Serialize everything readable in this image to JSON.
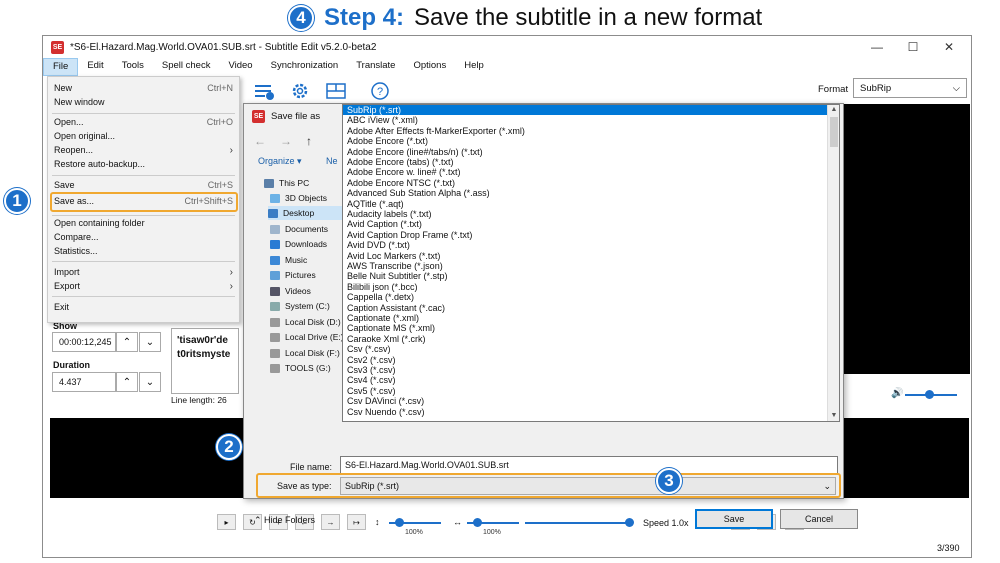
{
  "heading": {
    "number": "4",
    "step": "Step 4:",
    "text": "Save the subtitle in a new format"
  },
  "callouts": {
    "one": "1",
    "two": "2",
    "three": "3"
  },
  "window": {
    "logo": "SE",
    "title": "*S6-El.Hazard.Mag.World.OVA01.SUB.srt - Subtitle Edit v5.2.0-beta2",
    "minimize": "—",
    "maximize": "☐",
    "close": "✕"
  },
  "menubar": [
    "File",
    "Edit",
    "Tools",
    "Spell check",
    "Video",
    "Synchronization",
    "Translate",
    "Options",
    "Help"
  ],
  "format": {
    "label": "Format",
    "value": "SubRip",
    "arrow": "⌵"
  },
  "file_menu": [
    {
      "label": "New",
      "shortcut": "Ctrl+N"
    },
    {
      "label": "New window",
      "shortcut": ""
    },
    {
      "label": "Open...",
      "shortcut": "Ctrl+O"
    },
    {
      "label": "Open original...",
      "shortcut": ""
    },
    {
      "label": "Reopen...",
      "shortcut": "›"
    },
    {
      "label": "Restore auto-backup...",
      "shortcut": ""
    },
    {
      "label": "Save",
      "shortcut": "Ctrl+S"
    },
    {
      "label": "Save as...",
      "shortcut": "Ctrl+Shift+S"
    },
    {
      "label": "Open containing folder",
      "shortcut": ""
    },
    {
      "label": "Compare...",
      "shortcut": ""
    },
    {
      "label": "Statistics...",
      "shortcut": ""
    },
    {
      "label": "Import",
      "shortcut": "›"
    },
    {
      "label": "Export",
      "shortcut": "›"
    },
    {
      "label": "Exit",
      "shortcut": ""
    }
  ],
  "left": {
    "show_label": "Show",
    "show_value": "00:00:12,245",
    "duration_label": "Duration",
    "duration_value": "4.437",
    "text_preview": "'tisaw0r'de t0ritsmyste",
    "line_length": "Line length:  26",
    "up": "⌃",
    "down": "⌄"
  },
  "dialog": {
    "logo": "SE",
    "title": "Save file as",
    "back": "←",
    "forward": "→",
    "up": "↑",
    "organize": "Organize ▾",
    "new_folder": "Ne",
    "nav": [
      "This PC",
      "3D Objects",
      "Desktop",
      "Documents",
      "Downloads",
      "Music",
      "Pictures",
      "Videos",
      "System (C:)",
      "Local Disk (D:)",
      "Local Drive (E:)",
      "Local Disk (F:)",
      "TOOLS (G:)"
    ],
    "formats": [
      "SubRip (*.srt)",
      "ABC iView (*.xml)",
      "Adobe After Effects ft-MarkerExporter (*.xml)",
      "Adobe Encore (*.txt)",
      "Adobe Encore (line#/tabs/n) (*.txt)",
      "Adobe Encore (tabs) (*.txt)",
      "Adobe Encore w. line# (*.txt)",
      "Adobe Encore NTSC (*.txt)",
      "Advanced Sub Station Alpha (*.ass)",
      "AQTitle (*.aqt)",
      "Audacity labels (*.txt)",
      "Avid Caption (*.txt)",
      "Avid Caption Drop Frame (*.txt)",
      "Avid DVD (*.txt)",
      "Avid Loc Markers (*.txt)",
      "AWS Transcribe (*.json)",
      "Belle Nuit Subtitler (*.stp)",
      "Bilibili json (*.bcc)",
      "Cappella (*.detx)",
      "Caption Assistant (*.cac)",
      "Captionate (*.xml)",
      "Captionate MS (*.xml)",
      "Caraoke Xml (*.crk)",
      "Csv (*.csv)",
      "Csv2 (*.csv)",
      "Csv3 (*.csv)",
      "Csv4 (*.csv)",
      "Csv5 (*.csv)",
      "Csv DAVinci (*.csv)",
      "Csv Nuendo (*.csv)"
    ],
    "file_name_label": "File name:",
    "file_name_value": "S6-El.Hazard.Mag.World.OVA01.SUB.srt",
    "save_type_label": "Save as type:",
    "save_type_value": "SubRip (*.srt)",
    "hide_folders": "⌃ Hide Folders",
    "save_button": "Save",
    "cancel_button": "Cancel"
  },
  "bottom": {
    "buttons": [
      "▸",
      "↻",
      "+",
      "←",
      "→",
      "↦"
    ],
    "vzoom": "100%",
    "hzoom": "100%",
    "speed": "Speed 1.0x",
    "counter": "3/390",
    "accent": "#1d6fc9"
  }
}
